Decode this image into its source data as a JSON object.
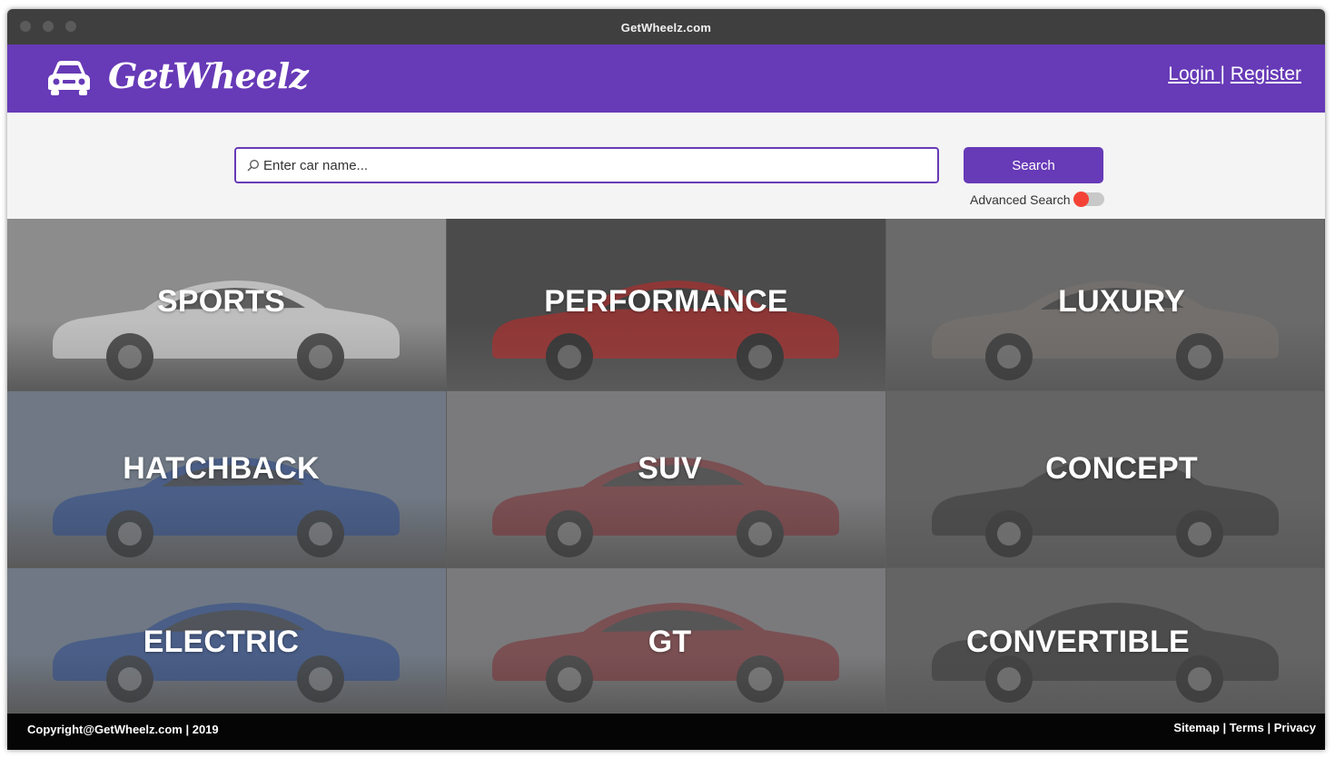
{
  "window": {
    "title": "GetWheelz.com"
  },
  "header": {
    "brand": "GetWheelz",
    "logo_icon": "car-front-icon",
    "login": "Login ",
    "separator": "|",
    "register": "Register"
  },
  "search": {
    "placeholder": "Enter car name...",
    "value": "",
    "button": "Search",
    "advanced_label": "Advanced Search",
    "advanced_enabled": false
  },
  "categories": [
    {
      "label": "SPORTS",
      "bg": "#8c8c8c",
      "car_color": "#e8e8e8"
    },
    {
      "label": "PERFORMANCE",
      "bg": "#4b4b4b",
      "car_color": "#c62828"
    },
    {
      "label": "LUXURY",
      "bg": "#6a6a6a",
      "car_color": "#7a7470"
    },
    {
      "label": "HATCHBACK",
      "bg": "#6f7884",
      "car_color": "#2c4a8a"
    },
    {
      "label": "SUV",
      "bg": "#7a7a7c",
      "car_color": "#7b2e33"
    },
    {
      "label": "CONCEPT",
      "bg": "#646464",
      "car_color": "#3a3a3a"
    },
    {
      "label": "ELECTRIC",
      "bg": "#6f7884",
      "car_color": "#2c4a8a"
    },
    {
      "label": "GT",
      "bg": "#7a7a7c",
      "car_color": "#7b2e33"
    },
    {
      "label": "CONVERTIBLE",
      "bg": "#646464",
      "car_color": "#3a3a3a"
    }
  ],
  "footer": {
    "copyright": "Copyright@GetWheelz.com | 2019",
    "links": [
      "Sitemap",
      "Terms",
      "Privacy"
    ]
  },
  "colors": {
    "brand": "#673ab7",
    "toggle_knob": "#f44336",
    "footer": "#050505"
  }
}
